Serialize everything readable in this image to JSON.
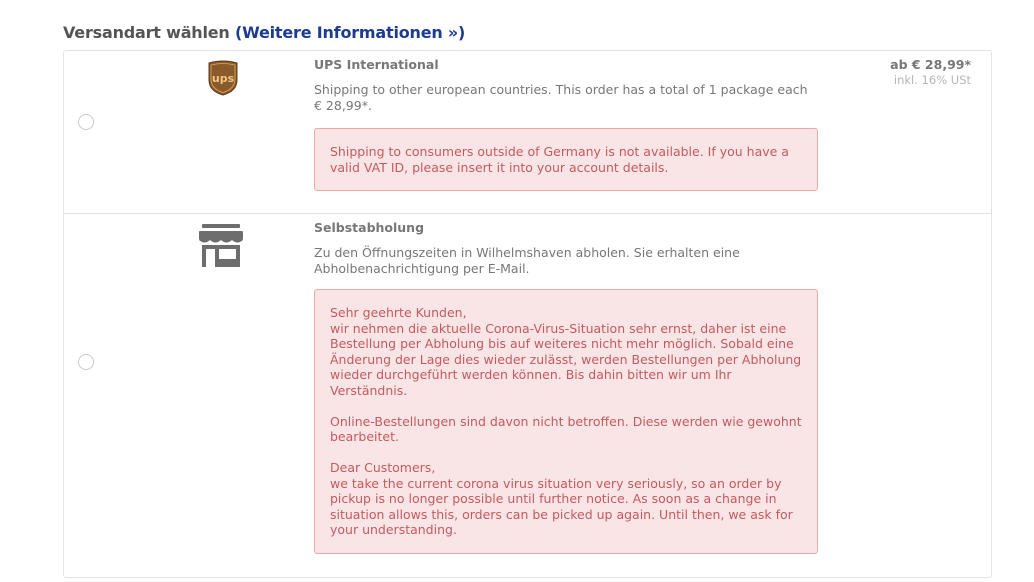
{
  "header": {
    "title": "Versandart wählen",
    "info_link": "(Weitere Informationen »)"
  },
  "methods": [
    {
      "title": "UPS International",
      "icon": "ups-logo-icon",
      "description": "Shipping to other european countries. This order has a total of 1 package each € 28,99*.",
      "alert": [
        "Shipping to consumers outside of Germany is not available. If you have a valid VAT ID, please insert it into your account details."
      ],
      "price": "ab € 28,99*",
      "tax": "inkl. 16% USt"
    },
    {
      "title": "Selbstabholung",
      "icon": "store-icon",
      "description": "Zu den Öffnungszeiten in Wilhelmshaven abholen. Sie erhalten eine Abholbenachrichtigung per E-Mail.",
      "alert": [
        "Sehr geehrte Kunden,\nwir nehmen die aktuelle Corona-Virus-Situation sehr ernst, daher ist eine Bestellung per Abholung bis auf weiteres nicht mehr möglich. Sobald eine Änderung der Lage dies wieder zulässt, werden Bestellungen per Abholung wieder durchgeführt werden können. Bis dahin bitten wir um Ihr Verständnis.",
        "Online-Bestellungen sind davon nicht betroffen. Diese werden wie gewohnt bearbeitet.",
        "Dear Customers,\nwe take the current corona virus situation very seriously, so an order by pickup is no longer possible until further notice. As soon as a change in situation allows this, orders can be picked up again. Until then, we ask for your understanding."
      ]
    }
  ],
  "colors": {
    "link": "#1d3c8f",
    "alert_bg": "#fae5e6",
    "alert_border": "#f0a7a8",
    "alert_text": "#c45a5f",
    "ups_brown": "#8b5a2b",
    "ups_gold": "#f2c583"
  }
}
